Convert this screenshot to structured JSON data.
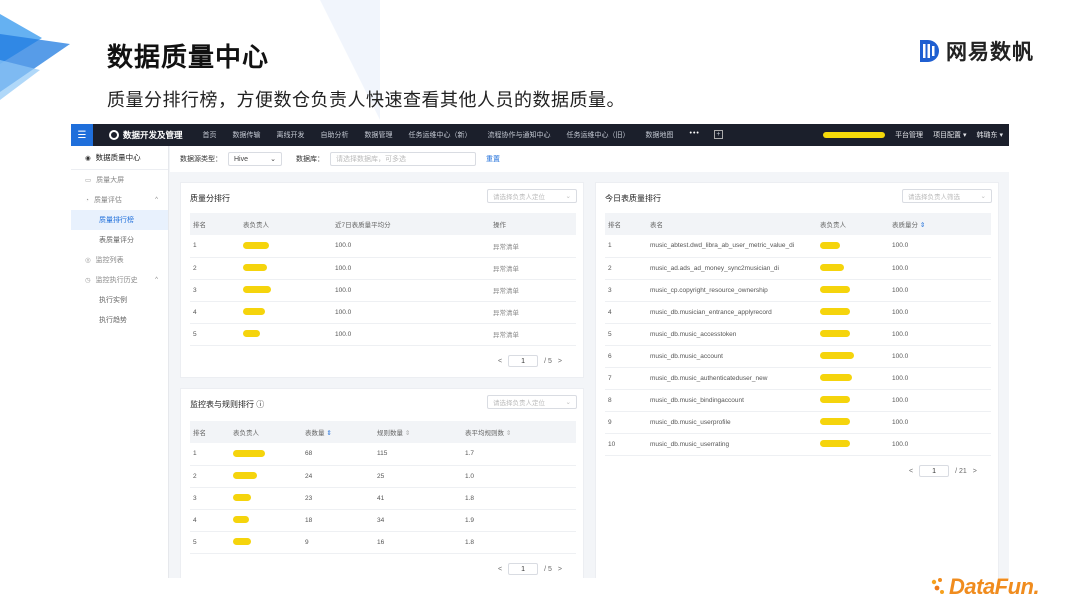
{
  "slide": {
    "title": "数据质量中心",
    "subtitle": "质量分排行榜，方便数仓负责人快速查看其他人员的数据质量。",
    "brand": "网易数帆",
    "footer_brand": "DataFun."
  },
  "app": {
    "logo_text": "数据开发及管理",
    "nav": [
      "首页",
      "数据传输",
      "离线开发",
      "自助分析",
      "数据管理",
      "任务运维中心（新）",
      "流程协作与通知中心",
      "任务运维中心（旧）",
      "数据地图"
    ],
    "nav_more": "•••",
    "nav_add": "+",
    "right_menu": {
      "platform": "平台管理",
      "project": "项目配置 ▾",
      "user": "韩璐东 ▾"
    },
    "sidebar": {
      "header": "数据质量中心",
      "items": [
        {
          "label": "质量大屏",
          "level": 1
        },
        {
          "label": "质量评估",
          "level": 1,
          "caret": "^"
        },
        {
          "label": "质量排行榜",
          "level": 2,
          "active": true
        },
        {
          "label": "表质量评分",
          "level": 2
        },
        {
          "label": "监控列表",
          "level": 1
        },
        {
          "label": "监控执行历史",
          "level": 1,
          "caret": "^"
        },
        {
          "label": "执行实例",
          "level": 2
        },
        {
          "label": "执行趋势",
          "level": 2
        }
      ]
    },
    "filters": {
      "datasource_label": "数据源类型：",
      "datasource_value": "Hive",
      "db_label": "数据库：",
      "db_placeholder": "请选择数据库，可多选",
      "reset": "重置"
    },
    "quality_rank": {
      "title": "质量分排行",
      "select_placeholder": "请选择负责人定位",
      "columns": [
        "排名",
        "表负责人",
        "近7日表质量平均分",
        "操作"
      ],
      "rows": [
        {
          "rank": "1",
          "score": "100.0",
          "op": "异常清单"
        },
        {
          "rank": "2",
          "score": "100.0",
          "op": "异常清单"
        },
        {
          "rank": "3",
          "score": "100.0",
          "op": "异常清单"
        },
        {
          "rank": "4",
          "score": "100.0",
          "op": "异常清单"
        },
        {
          "rank": "5",
          "score": "100.0",
          "op": "异常清单"
        }
      ],
      "pager": {
        "prev": "<",
        "page": "1",
        "total": "/ 5",
        "next": ">"
      }
    },
    "monitor_rank": {
      "title": "监控表与规则排行 ⓘ",
      "select_placeholder": "请选择负责人定位",
      "columns": [
        "排名",
        "表负责人",
        "表数量",
        "规则数量",
        "表平均规则数"
      ],
      "rows": [
        {
          "rank": "1",
          "tables": "68",
          "rules": "115",
          "avg": "1.7"
        },
        {
          "rank": "2",
          "tables": "24",
          "rules": "25",
          "avg": "1.0"
        },
        {
          "rank": "3",
          "tables": "23",
          "rules": "41",
          "avg": "1.8"
        },
        {
          "rank": "4",
          "tables": "18",
          "rules": "34",
          "avg": "1.9"
        },
        {
          "rank": "5",
          "tables": "9",
          "rules": "16",
          "avg": "1.8"
        }
      ],
      "pager": {
        "prev": "<",
        "page": "1",
        "total": "/ 5",
        "next": ">"
      }
    },
    "today_rank": {
      "title": "今日表质量排行",
      "select_placeholder": "请选择负责人筛选",
      "columns": [
        "排名",
        "表名",
        "表负责人",
        "表质量分"
      ],
      "rows": [
        {
          "rank": "1",
          "table": "music_abtest.dwd_libra_ab_user_metric_value_di",
          "score": "100.0"
        },
        {
          "rank": "2",
          "table": "music_ad.ads_ad_money_sync2musician_di",
          "score": "100.0"
        },
        {
          "rank": "3",
          "table": "music_cp.copyright_resource_ownership",
          "score": "100.0"
        },
        {
          "rank": "4",
          "table": "music_db.musician_entrance_applyrecord",
          "score": "100.0"
        },
        {
          "rank": "5",
          "table": "music_db.music_accesstoken",
          "score": "100.0"
        },
        {
          "rank": "6",
          "table": "music_db.music_account",
          "score": "100.0"
        },
        {
          "rank": "7",
          "table": "music_db.music_authenticateduser_new",
          "score": "100.0"
        },
        {
          "rank": "8",
          "table": "music_db.music_bindingaccount",
          "score": "100.0"
        },
        {
          "rank": "9",
          "table": "music_db.music_userprofile",
          "score": "100.0"
        },
        {
          "rank": "10",
          "table": "music_db.music_userrating",
          "score": "100.0"
        }
      ],
      "pager": {
        "prev": "<",
        "page": "1",
        "total": "/ 21",
        "next": ">"
      }
    },
    "colors": {
      "accent": "#1f6fdb",
      "topbar": "#1b1f2b",
      "redaction": "#f5d40c"
    }
  }
}
